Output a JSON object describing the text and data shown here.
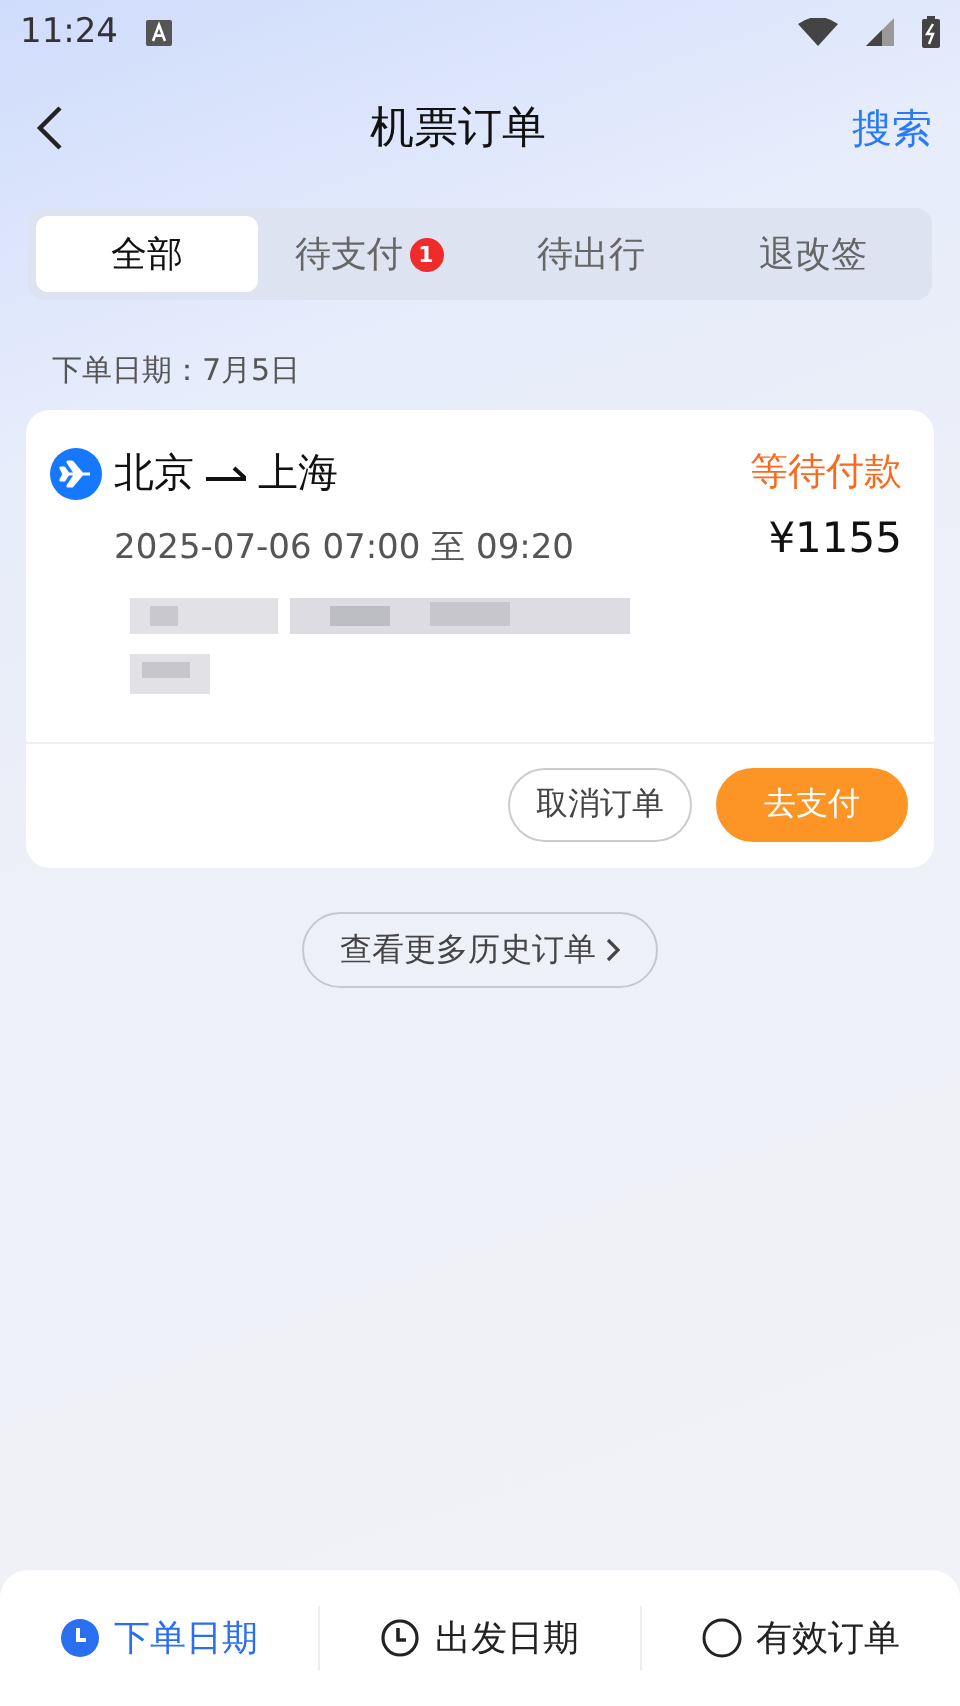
{
  "status_bar": {
    "time": "11:24"
  },
  "header": {
    "title": "机票订单",
    "action": "搜索"
  },
  "tabs": [
    {
      "label": "全部",
      "selected": true
    },
    {
      "label": "待支付",
      "selected": false,
      "badge": "1"
    },
    {
      "label": "待出行",
      "selected": false
    },
    {
      "label": "退改签",
      "selected": false
    }
  ],
  "date_label": "下单日期：7月5日",
  "orders": [
    {
      "route_from": "北京",
      "route_to": "上海",
      "status": "等待付款",
      "time": "2025-07-06 07:00 至 09:20",
      "price": "¥1155",
      "actions": [
        {
          "label": "取消订单",
          "kind": "outline"
        },
        {
          "label": "去支付",
          "kind": "primary"
        }
      ]
    }
  ],
  "more_button": "查看更多历史订单",
  "bottom_bar": [
    {
      "label": "下单日期",
      "kind": "sort",
      "selected": true
    },
    {
      "label": "出发日期",
      "kind": "sort",
      "selected": false
    },
    {
      "label": "有效订单",
      "kind": "toggle",
      "checked": false
    }
  ]
}
